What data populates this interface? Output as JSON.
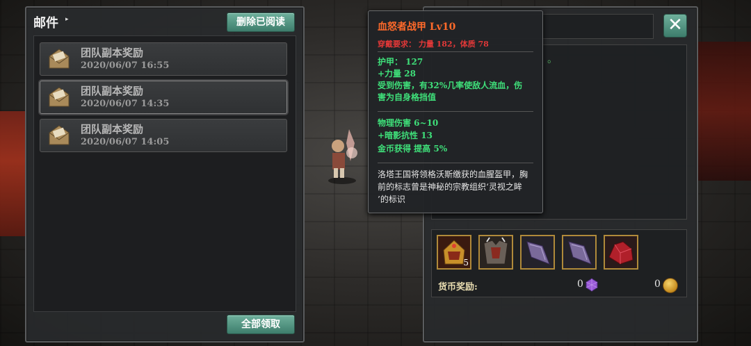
{
  "mail_panel": {
    "title": "邮件",
    "delete_read_label": "删除已阅读",
    "claim_all_label": "全部领取",
    "items": [
      {
        "name": "团队副本奖励",
        "date": "2020/06/07  16:55"
      },
      {
        "name": "团队副本奖励",
        "date": "2020/06/07  14:35"
      },
      {
        "name": "团队副本奖励",
        "date": "2020/06/07  14:05"
      }
    ]
  },
  "tooltip": {
    "item_name": "血怒者战甲  Lv10",
    "requirement": "穿戴要求：  力量 182，体质 78",
    "stats_1": [
      "护甲：  127",
      "+力量  28",
      "受到伤害，有32%几率使敌人流血，伤",
      "害为自身格挡值"
    ],
    "stats_2": [
      "物理伤害  6~10",
      "+暗影抗性  13",
      "金币获得  提高  5%"
    ],
    "lore": [
      "洛塔王国将领格沃斯缴获的血腥盔甲，胸",
      "前的标志曾是神秘的宗教组织‘灵视之眸",
      "’的标识"
    ]
  },
  "detail_panel": {
    "close_icon": "close-icon",
    "reward_count": "5",
    "currency_label": "货币奖励:",
    "gem_amount": "0",
    "coin_amount": "0",
    "peek_text": "。"
  },
  "colors": {
    "accent_green": "#4f9a86",
    "item_name": "#ff6a2a",
    "stat_green": "#3fe07a",
    "requirement_red": "#e23838",
    "slot_gold": "#b08a3a"
  }
}
